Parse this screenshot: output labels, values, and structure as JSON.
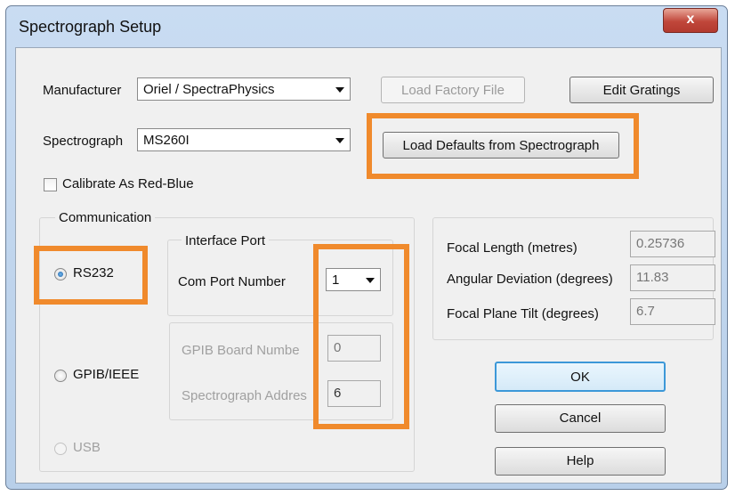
{
  "window": {
    "title": "Spectrograph Setup",
    "close_label": "x"
  },
  "manufacturer": {
    "label": "Manufacturer",
    "value": "Oriel / SpectraPhysics"
  },
  "spectrograph": {
    "label": "Spectrograph",
    "value": "MS260I"
  },
  "buttons": {
    "load_factory": "Load Factory File",
    "edit_gratings": "Edit Gratings",
    "load_defaults": "Load Defaults from Spectrograph",
    "ok": "OK",
    "cancel": "Cancel",
    "help": "Help"
  },
  "calibrate": {
    "label": "Calibrate As Red-Blue",
    "checked": false
  },
  "communication": {
    "group_label": "Communication",
    "rs232": "RS232",
    "gpib": "GPIB/IEEE",
    "usb": "USB",
    "selected": "RS232"
  },
  "interface_port": {
    "group_label": "Interface Port",
    "com_port_label": "Com Port Number",
    "com_port_value": "1",
    "gpib_board_label": "GPIB Board Numbe",
    "gpib_board_value": "0",
    "spectrograph_address_label": "Spectrograph Addres",
    "spectrograph_address_value": "6"
  },
  "optics": {
    "focal_length_label": "Focal Length (metres)",
    "focal_length_value": "0.25736",
    "angular_deviation_label": "Angular Deviation (degrees)",
    "angular_deviation_value": "11.83",
    "focal_plane_tilt_label": "Focal Plane Tilt (degrees)",
    "focal_plane_tilt_value": "6.7"
  },
  "colors": {
    "highlight": "#f08a2c",
    "accent": "#3c98d8",
    "close": "#c0463a"
  }
}
